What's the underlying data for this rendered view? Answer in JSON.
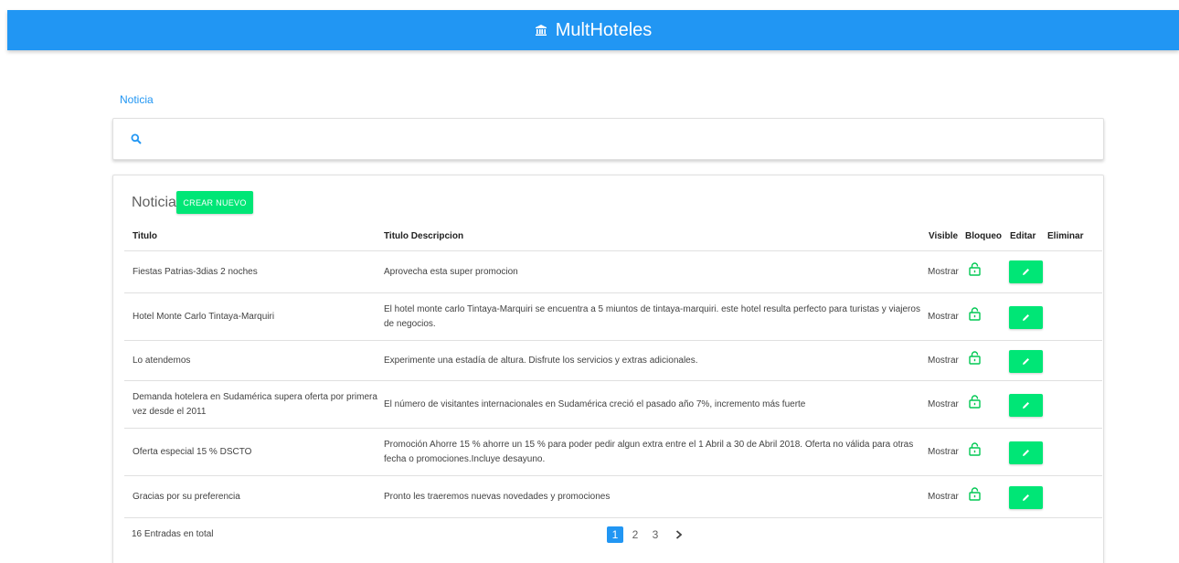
{
  "app": {
    "title": "MultHoteles",
    "icon": "bank-icon",
    "bar_color": "#2196f3",
    "accent_color": "#00e676"
  },
  "breadcrumb": {
    "current": "Noticia"
  },
  "search": {
    "placeholder": "",
    "value": ""
  },
  "table": {
    "title": "Noticia",
    "create_label": "CREAR NUEVO",
    "columns": {
      "titulo": "Titulo",
      "descripcion": "Titulo Descripcion",
      "visible": "Visible",
      "bloqueo": "Bloqueo",
      "editar": "Editar",
      "eliminar": "Eliminar"
    },
    "rows": [
      {
        "titulo": "Fiestas Patrias-3dias 2 noches",
        "descripcion": "Aprovecha esta super promocion",
        "visible": "Mostrar"
      },
      {
        "titulo": "Hotel Monte Carlo Tintaya-Marquiri",
        "descripcion": "El hotel monte carlo Tintaya-Marquiri se encuentra a 5 miuntos de tintaya-marquiri. este hotel resulta perfecto para turistas y viajeros de negocios.",
        "visible": "Mostrar"
      },
      {
        "titulo": "Lo atendemos",
        "descripcion": "Experimente una estadía de altura. Disfrute los servicios y extras adicionales.",
        "visible": "Mostrar"
      },
      {
        "titulo": "Demanda hotelera en Sudamérica supera oferta por primera vez desde el 2011",
        "descripcion": "El número de visitantes internacionales en Sudamérica creció el pasado año 7%, incremento más fuerte",
        "visible": "Mostrar"
      },
      {
        "titulo": "Oferta especial 15 % DSCTO",
        "descripcion": "Promoción Ahorre 15 % ahorre un 15 % para poder pedir algun extra entre el 1 Abril a 30 de Abril 2018. Oferta no válida para otras fecha o promociones.Incluye desayuno.",
        "visible": "Mostrar"
      },
      {
        "titulo": "Gracias por su preferencia",
        "descripcion": "Pronto les traeremos nuevas novedades y promociones",
        "visible": "Mostrar"
      }
    ],
    "total_label": "16 Entradas en total",
    "pagination": {
      "pages": [
        "1",
        "2",
        "3"
      ],
      "current": "1"
    },
    "lock_icon": "unlock-icon",
    "edit_icon": "pencil-icon"
  }
}
